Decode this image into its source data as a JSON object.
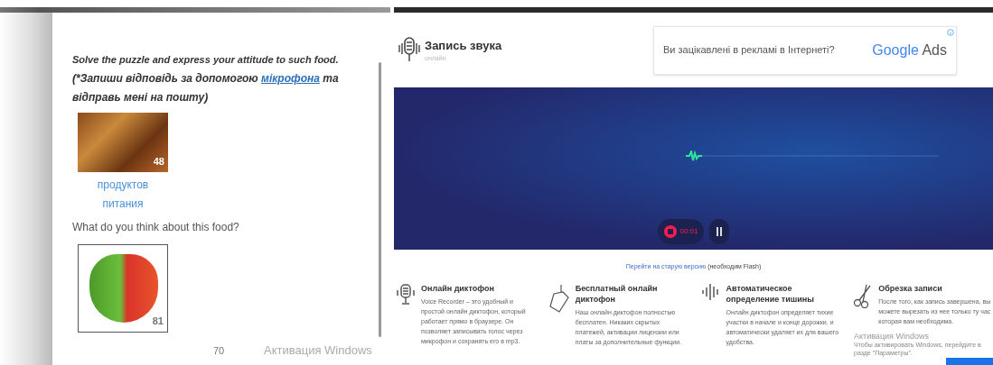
{
  "left_page": {
    "task": "Solve the puzzle and express your attitude to such food.",
    "instruction": "(*Запиши відповідь за допомогою ",
    "instruction_link": "мікрофона",
    "instruction_end": " та відправь мені на пошту)",
    "images": [
      {
        "kind": "fast-food",
        "badge": "48",
        "caption": [
          "продуктов",
          "питания"
        ]
      },
      {
        "kind": "vegetables",
        "badge": "81"
      }
    ],
    "question": "What do you think about this food?",
    "page_number": "70",
    "activation": "Активация Windows"
  },
  "recorder_site": {
    "title": "Запись звука",
    "subtitle": "онлайн",
    "ad": {
      "text": "Ви зацікавлені в рекламі в Інтернеті?",
      "brand": "Google",
      "brand_suffix": "Ads"
    },
    "timer": "00:01",
    "old_link": "Перейти на старую версию",
    "old_note": "(необходим Flash)",
    "features": [
      {
        "title": "Онлайн диктофон",
        "text": "Voice Recorder – это удобный и простой онлайн диктофон, который работает прямо в браузере. Он позволяет записывать голос через микрофон и сохранять его в mp3."
      },
      {
        "title": "Бесплатный онлайн диктофон",
        "text": "Наш онлайн диктофон полностью бесплатен. Никаких скрытых платежей, активации лицензии или платы за дополнительные функции."
      },
      {
        "title": "Автоматическое определение тишины",
        "text": "Онлайн диктофон определяет тихие участки в начале и конце дорожки, и автоматически удаляет их для вашего удобства."
      },
      {
        "title": "Обрезка записи",
        "text": "После того, как запись завершена, вы можете вырезать из нее только ту час которая вам необходима."
      }
    ],
    "activation": {
      "title": "Активация Windows",
      "text": "Чтобы активировать Windows, перейдите в разде \"Параметры\"."
    }
  }
}
